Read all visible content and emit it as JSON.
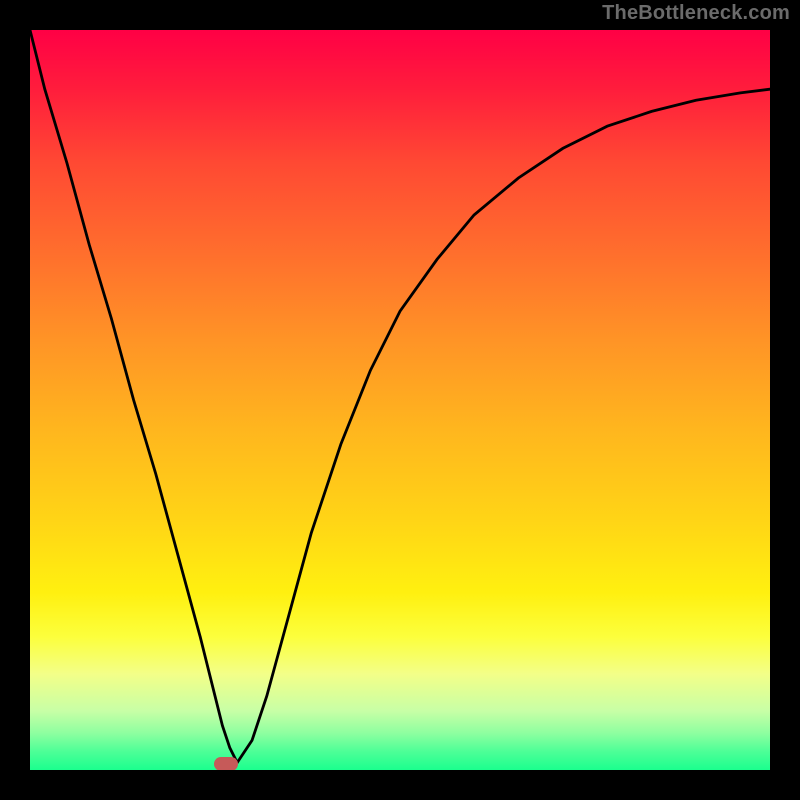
{
  "watermark": "TheBottleneck.com",
  "chart_data": {
    "type": "line",
    "title": "",
    "xlabel": "",
    "ylabel": "",
    "xlim": [
      0,
      100
    ],
    "ylim": [
      0,
      100
    ],
    "grid": false,
    "series": [
      {
        "name": "curve",
        "x": [
          0,
          2,
          5,
          8,
          11,
          14,
          17,
          20,
          23,
          25,
          26,
          27,
          28,
          30,
          32,
          35,
          38,
          42,
          46,
          50,
          55,
          60,
          66,
          72,
          78,
          84,
          90,
          96,
          100
        ],
        "y": [
          100,
          92,
          82,
          71,
          61,
          50,
          40,
          29,
          18,
          10,
          6,
          3,
          1,
          4,
          10,
          21,
          32,
          44,
          54,
          62,
          69,
          75,
          80,
          84,
          87,
          89,
          90.5,
          91.5,
          92
        ]
      }
    ],
    "marker": {
      "x": 26.5,
      "y": 0.8
    },
    "background_gradient": {
      "top": "#ff0045",
      "mid": "#ffd416",
      "bottom": "#1bff8e"
    },
    "frame_color": "#000000"
  }
}
